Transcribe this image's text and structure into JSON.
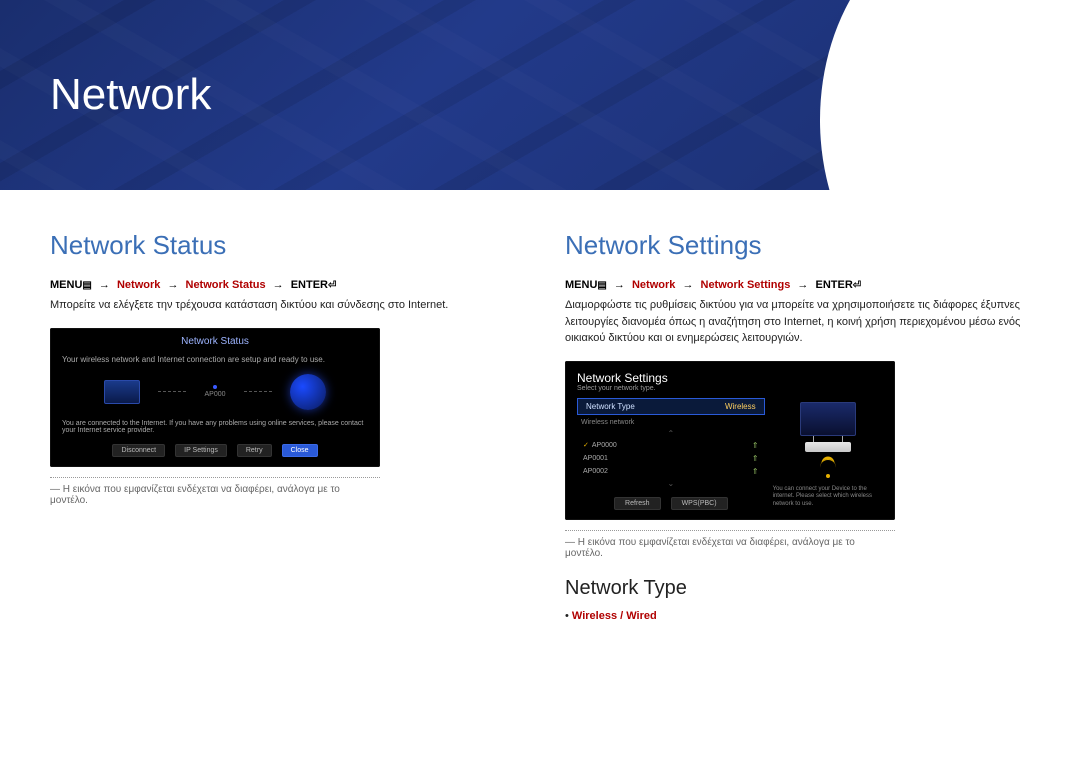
{
  "banner": {
    "title": "Network"
  },
  "left": {
    "title": "Network Status",
    "path": {
      "menu": "MENU",
      "s1": "Network",
      "s2": "Network Status",
      "enter": "ENTER"
    },
    "description": "Μπορείτε να ελέγξετε την τρέχουσα κατάσταση δικτύου και σύνδεσης στο Internet.",
    "tv": {
      "title": "Network Status",
      "line1": "Your wireless network and Internet connection are setup and ready to use.",
      "ap": "AP000",
      "line2": "You are connected to the Internet. If you have any problems using online services, please contact your Internet service provider.",
      "buttons": {
        "b1": "Disconnect",
        "b2": "IP Settings",
        "b3": "Retry",
        "b4": "Close"
      }
    },
    "note": "Η εικόνα που εμφανίζεται ενδέχεται να διαφέρει, ανάλογα με το μοντέλο."
  },
  "right": {
    "title": "Network Settings",
    "path": {
      "menu": "MENU",
      "s1": "Network",
      "s2": "Network Settings",
      "enter": "ENTER"
    },
    "description": "Διαμορφώστε τις ρυθμίσεις δικτύου για να μπορείτε να χρησιμοποιήσετε τις διάφορες έξυπνες λειτουργίες διανομέα όπως η αναζήτηση στο Internet, η κοινή χρήση περιεχομένου μέσω ενός οικιακού δικτύου και οι ενημερώσεις λειτουργιών.",
    "tv": {
      "title": "Network Settings",
      "subtitle": "Select your network type.",
      "select_label": "Network Type",
      "select_value": "Wireless",
      "list_label": "Wireless network",
      "aps": [
        "AP0000",
        "AP0001",
        "AP0002"
      ],
      "right_text": "You can connect your Device to the internet. Please select which wireless network to use.",
      "buttons": {
        "b1": "Refresh",
        "b2": "WPS(PBC)"
      }
    },
    "note": "Η εικόνα που εμφανίζεται ενδέχεται να διαφέρει, ανάλογα με το μοντέλο.",
    "sub": {
      "title": "Network Type",
      "options": "Wireless / Wired"
    }
  }
}
